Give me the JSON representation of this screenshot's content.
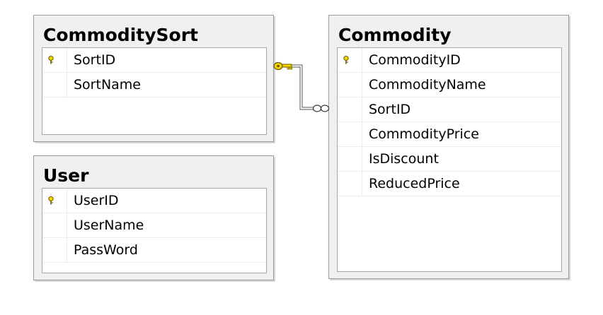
{
  "tables": [
    {
      "title": "CommoditySort",
      "fields": [
        {
          "name": "SortID",
          "primary_key": true
        },
        {
          "name": "SortName",
          "primary_key": false
        }
      ]
    },
    {
      "title": "User",
      "fields": [
        {
          "name": "UserID",
          "primary_key": true
        },
        {
          "name": "UserName",
          "primary_key": false
        },
        {
          "name": "PassWord",
          "primary_key": false
        }
      ]
    },
    {
      "title": "Commodity",
      "fields": [
        {
          "name": "CommodityID",
          "primary_key": true
        },
        {
          "name": "CommodityName",
          "primary_key": false
        },
        {
          "name": "SortID",
          "primary_key": false
        },
        {
          "name": "CommodityPrice",
          "primary_key": false
        },
        {
          "name": "IsDiscount",
          "primary_key": false
        },
        {
          "name": "ReducedPrice",
          "primary_key": false
        }
      ]
    }
  ],
  "relationship": {
    "from_table": "CommoditySort",
    "to_table": "Commodity",
    "from_end": "key-icon",
    "to_end": "infinity-icon"
  },
  "colors": {
    "key": "#f2d200",
    "key_outline": "#6b5a00",
    "table_background": "#f0f0f0",
    "grid_background": "#ffffff"
  }
}
